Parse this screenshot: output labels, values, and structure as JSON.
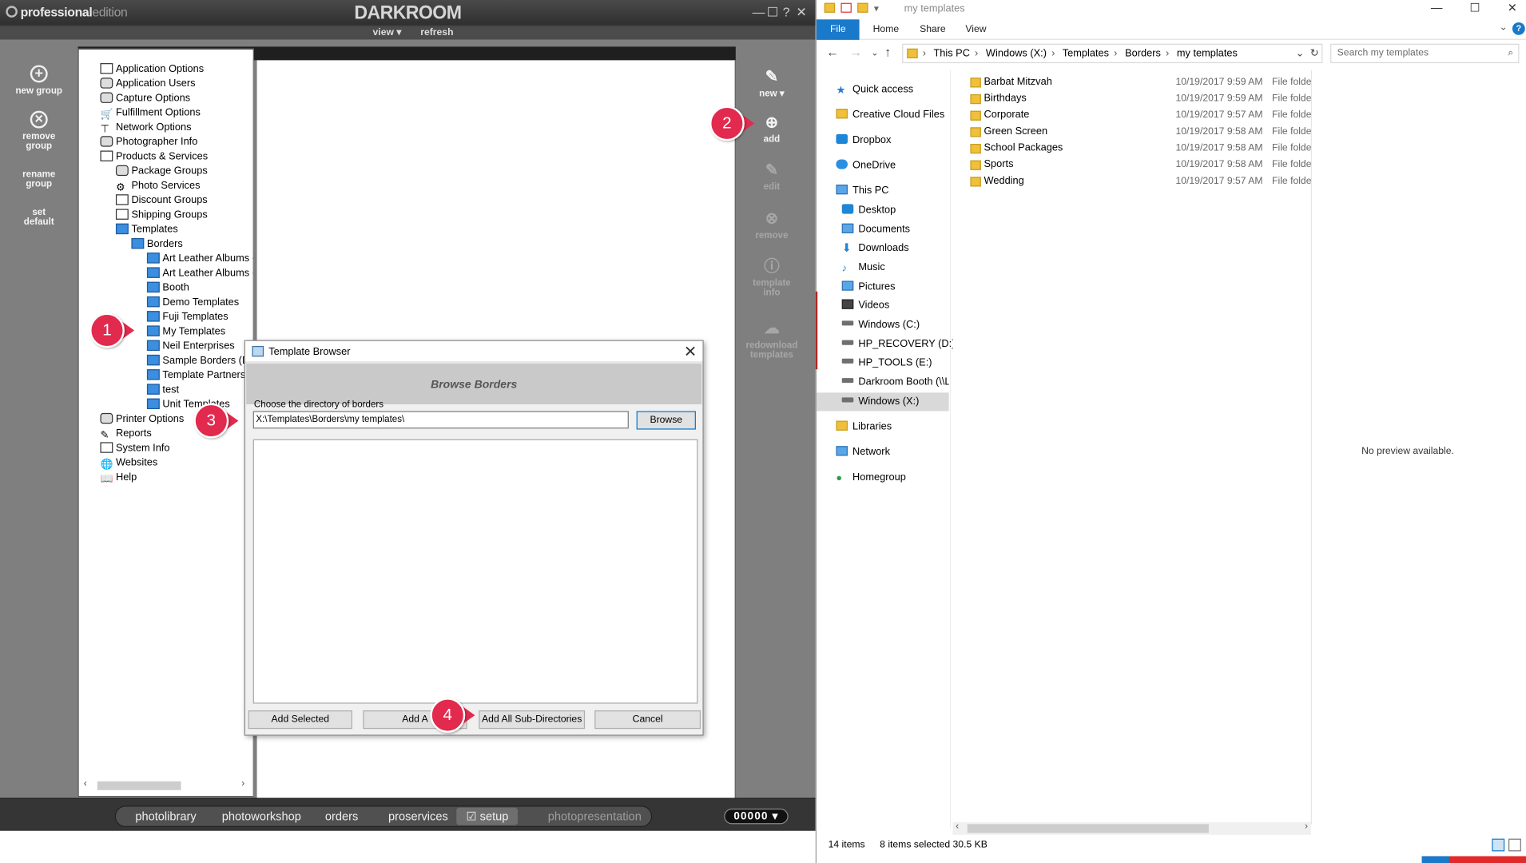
{
  "darkroom": {
    "brand": "professional",
    "brand_suffix": "edition",
    "logo": "DARKROOM",
    "window_controls": [
      "—",
      "☐",
      "?",
      "✕"
    ],
    "menu": {
      "view": "view ▾",
      "refresh": "refresh"
    },
    "left_buttons": [
      {
        "label_1": "new group",
        "label_2": "",
        "icon": "plus-circle-icon"
      },
      {
        "label_1": "remove",
        "label_2": "group",
        "icon": "x-circle-icon"
      },
      {
        "label_1": "rename",
        "label_2": "group",
        "icon": ""
      },
      {
        "label_1": "set",
        "label_2": "default",
        "icon": ""
      }
    ],
    "tree": [
      {
        "label": "Application Options"
      },
      {
        "label": "Application Users"
      },
      {
        "label": "Capture Options"
      },
      {
        "label": "Fulfillment Options"
      },
      {
        "label": "Network Options"
      },
      {
        "label": "Photographer Info"
      },
      {
        "label": "Products & Services"
      },
      {
        "label": "Package Groups"
      },
      {
        "label": "Photo Services"
      },
      {
        "label": "Discount Groups"
      },
      {
        "label": "Shipping Groups"
      },
      {
        "label": "Templates"
      },
      {
        "label": "Borders"
      },
      {
        "label": "Art Leather Albums -"
      },
      {
        "label": "Art Leather Albums -"
      },
      {
        "label": "Booth"
      },
      {
        "label": "Demo Templates"
      },
      {
        "label": "Fuji Templates"
      },
      {
        "label": "My Templates"
      },
      {
        "label": "Neil Enterprises"
      },
      {
        "label": "Sample Borders (De"
      },
      {
        "label": "Template Partners"
      },
      {
        "label": "test"
      },
      {
        "label": "Unit Templates"
      },
      {
        "label": "Printer Options"
      },
      {
        "label": "Reports"
      },
      {
        "label": "System Info"
      },
      {
        "label": "Websites"
      },
      {
        "label": "Help"
      }
    ],
    "right_buttons": [
      {
        "label_1": "new ▾",
        "label_2": "",
        "icon": "✎"
      },
      {
        "label_1": "add",
        "label_2": "",
        "icon": "⊕"
      },
      {
        "label_1": "edit",
        "label_2": "",
        "icon": "✎"
      },
      {
        "label_1": "remove",
        "label_2": "",
        "icon": "⊗"
      },
      {
        "label_1": "template",
        "label_2": "info",
        "icon": "ⓘ"
      },
      {
        "label_1": "redownload",
        "label_2": "templates",
        "icon": "☁"
      }
    ],
    "bottom_tabs": [
      "photolibrary",
      "photoworkshop",
      "orders",
      "proservices",
      "setup",
      "photopresentation"
    ],
    "counter": "00000 ▾"
  },
  "dialog": {
    "title": "Template Browser",
    "close": "✕",
    "header": "Browse Borders",
    "label": "Choose the directory of borders",
    "path": "X:\\Templates\\Borders\\my templates\\",
    "browse": "Browse",
    "buttons": [
      "Add Selected",
      "Add A",
      "Add All Sub-Directories",
      "Cancel"
    ]
  },
  "markers": [
    "1",
    "2",
    "3",
    "4"
  ],
  "explorer": {
    "title": "my templates",
    "ribbon_tabs": [
      "File",
      "Home",
      "Share",
      "View"
    ],
    "help": "?",
    "address": [
      "This PC",
      "Windows (X:)",
      "Templates",
      "Borders",
      "my templates"
    ],
    "search_placeholder": "Search my templates",
    "nav": [
      {
        "label": "Quick access"
      },
      {
        "label": "Creative Cloud Files"
      },
      {
        "label": "Dropbox"
      },
      {
        "label": "OneDrive"
      },
      {
        "label": "This PC"
      },
      {
        "label": "Desktop"
      },
      {
        "label": "Documents"
      },
      {
        "label": "Downloads"
      },
      {
        "label": "Music"
      },
      {
        "label": "Pictures"
      },
      {
        "label": "Videos"
      },
      {
        "label": "Windows  (C:)"
      },
      {
        "label": "HP_RECOVERY (D:)"
      },
      {
        "label": "HP_TOOLS (E:)"
      },
      {
        "label": "Darkroom Booth (\\\\La"
      },
      {
        "label": "Windows  (X:)"
      },
      {
        "label": "Libraries"
      },
      {
        "label": "Network"
      },
      {
        "label": "Homegroup"
      }
    ],
    "files": [
      {
        "name": "Barbat Mitzvah",
        "date": "10/19/2017 9:59 AM",
        "type": "File folde"
      },
      {
        "name": "Birthdays",
        "date": "10/19/2017 9:59 AM",
        "type": "File folde"
      },
      {
        "name": "Corporate",
        "date": "10/19/2017 9:57 AM",
        "type": "File folde"
      },
      {
        "name": "Green Screen",
        "date": "10/19/2017 9:58 AM",
        "type": "File folde"
      },
      {
        "name": "School Packages",
        "date": "10/19/2017 9:58 AM",
        "type": "File folde"
      },
      {
        "name": "Sports",
        "date": "10/19/2017 9:58 AM",
        "type": "File folde"
      },
      {
        "name": "Wedding",
        "date": "10/19/2017 9:57 AM",
        "type": "File folde"
      }
    ],
    "preview": "No preview available.",
    "status": {
      "items": "14 items",
      "selected": "8 items selected",
      "size": "30.5 KB"
    }
  }
}
